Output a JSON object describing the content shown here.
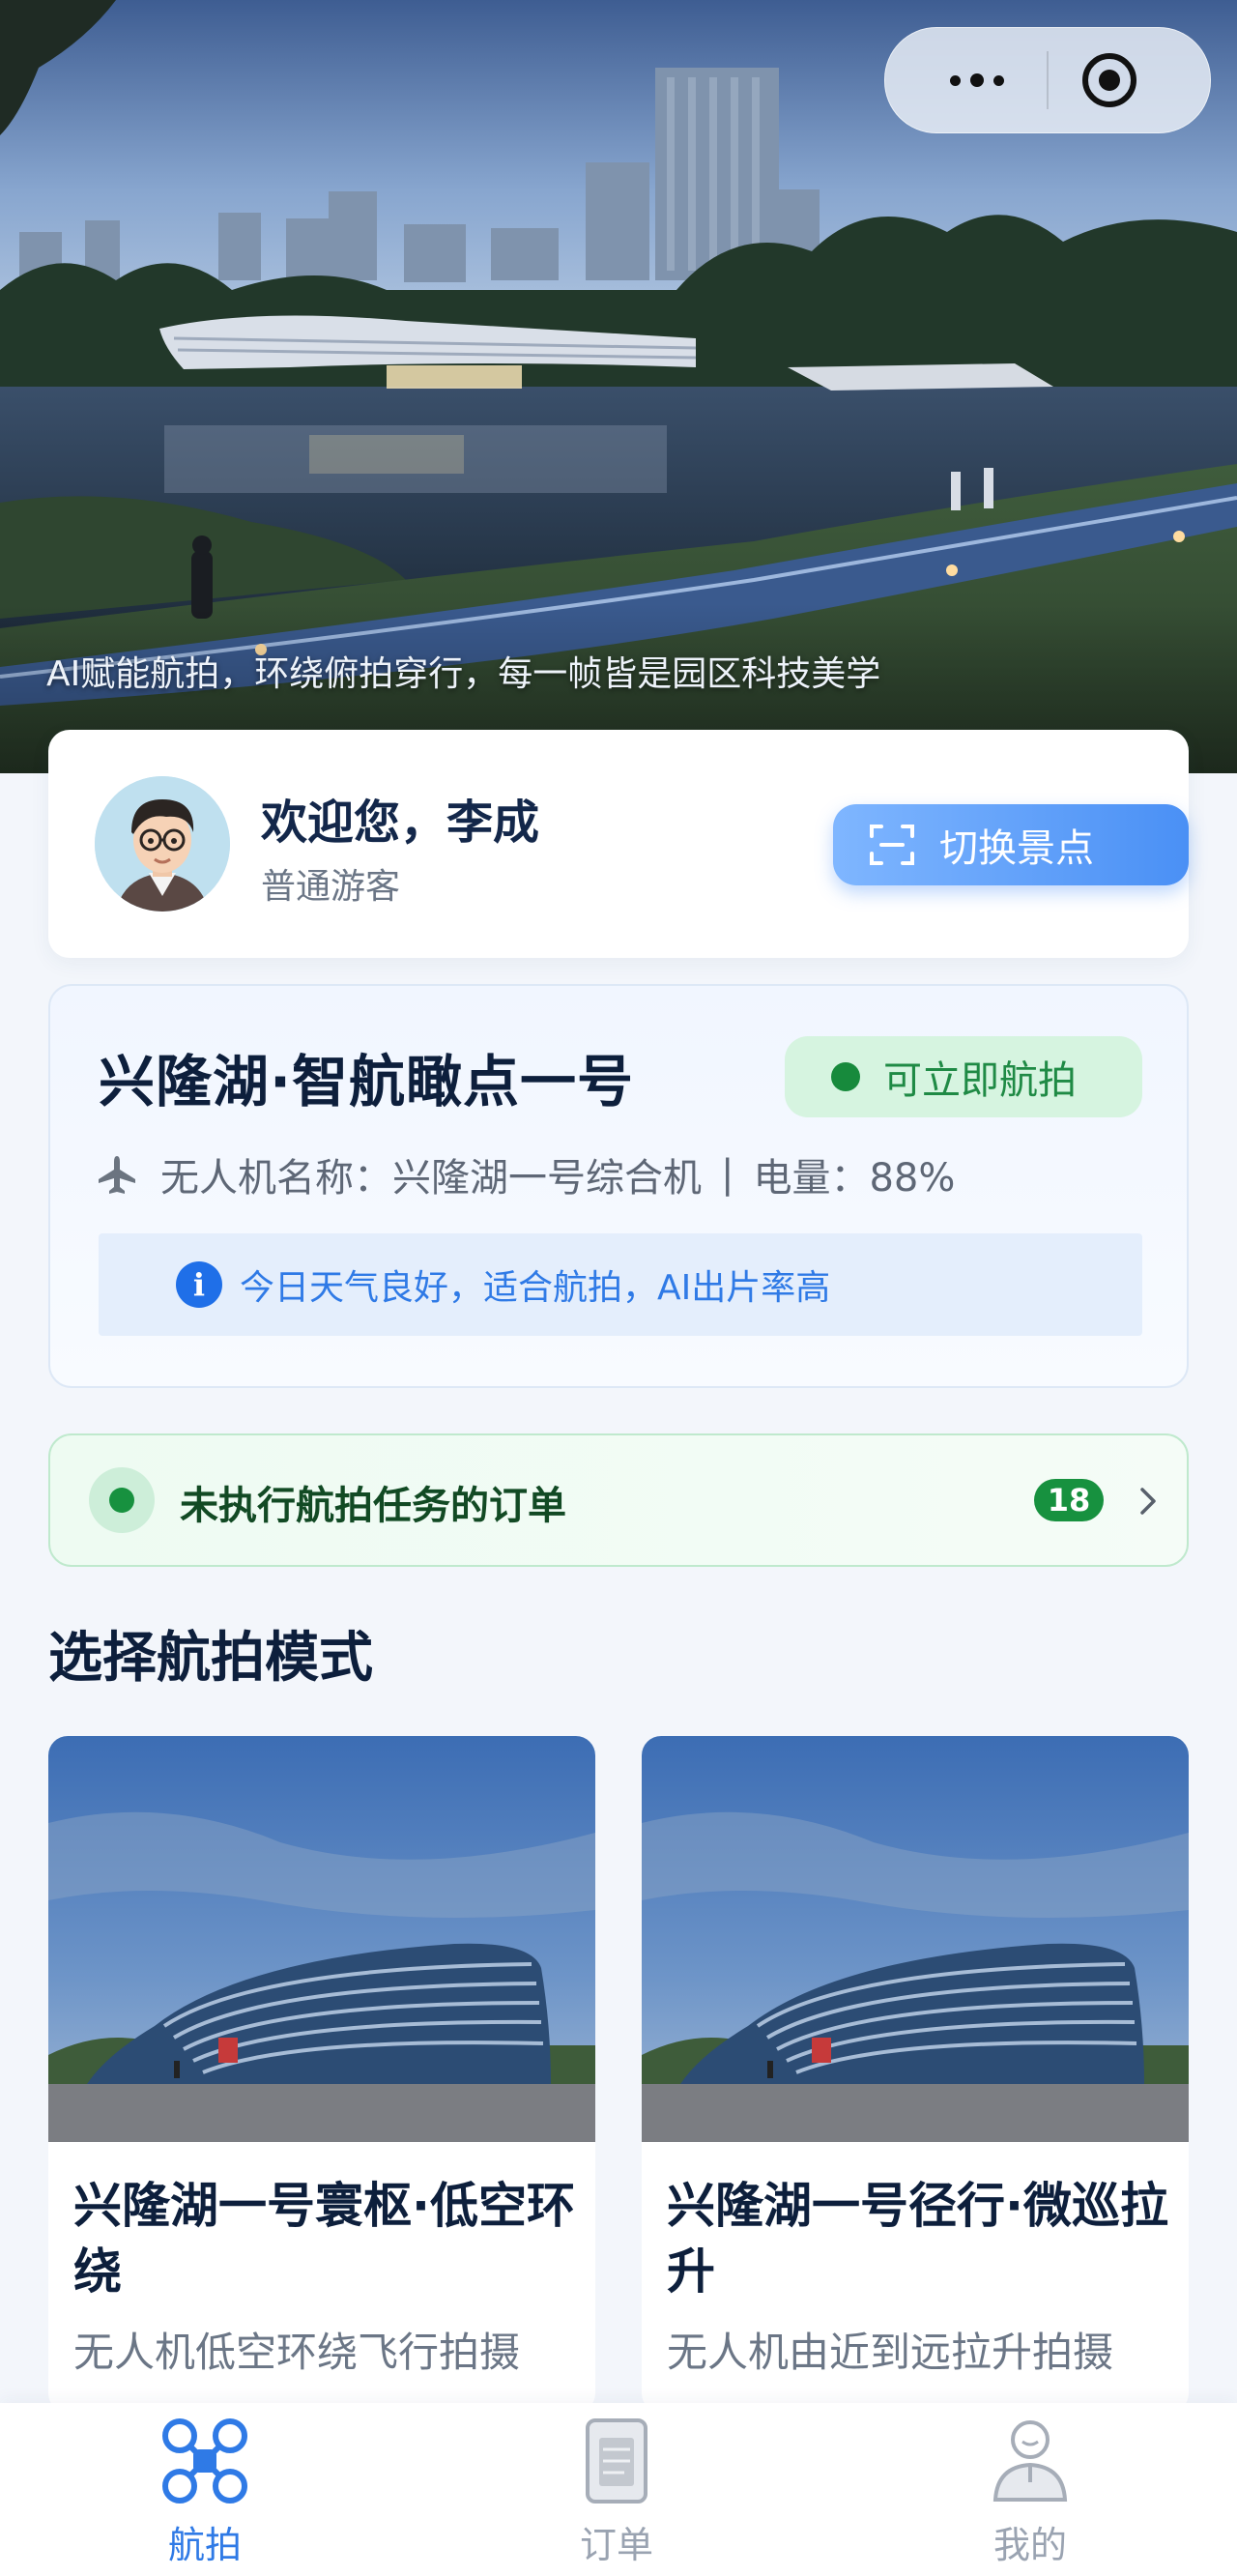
{
  "hero": {
    "caption": "AI赋能航拍，环绕俯拍穿行，每一帧皆是园区科技美学"
  },
  "capsule": {
    "more_icon": "more-dots-icon",
    "close_icon": "target-close-icon"
  },
  "welcome": {
    "title": "欢迎您，李成",
    "subtitle": "普通游客",
    "switch_label": "切换景点"
  },
  "spot": {
    "title": "兴隆湖·智航瞰点一号",
    "status": "可立即航拍",
    "drone_name": "无人机名称：兴隆湖一号综合机",
    "separator": "|",
    "battery": "电量：88%",
    "tip": "今日天气良好，适合航拍，AI出片率高",
    "tip_icon_glyph": "i"
  },
  "orders": {
    "label": "未执行航拍任务的订单",
    "count": "18"
  },
  "modes": {
    "section_title": "选择航拍模式",
    "items": [
      {
        "title": "兴隆湖一号寰枢·低空环绕",
        "desc": "无人机低空环绕飞行拍摄"
      },
      {
        "title": "兴隆湖一号径行·微巡拉升",
        "desc": "无人机由近到远拉升拍摄"
      }
    ]
  },
  "tabs": [
    {
      "label": "航拍",
      "icon": "drone-icon",
      "active": true
    },
    {
      "label": "订单",
      "icon": "order-icon",
      "active": false
    },
    {
      "label": "我的",
      "icon": "profile-icon",
      "active": false
    }
  ],
  "colors": {
    "accent": "#2f7ae6",
    "success": "#17913f",
    "title": "#0d1f3c"
  }
}
